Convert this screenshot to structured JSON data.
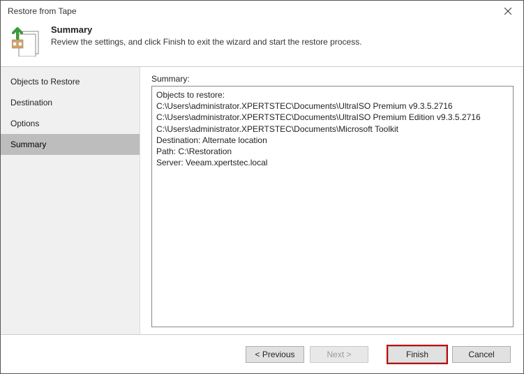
{
  "window": {
    "title": "Restore from Tape"
  },
  "header": {
    "title": "Summary",
    "subtitle": "Review the settings, and click Finish to exit the wizard and start the restore process."
  },
  "sidebar": {
    "items": [
      {
        "label": "Objects to Restore"
      },
      {
        "label": "Destination"
      },
      {
        "label": "Options"
      },
      {
        "label": "Summary"
      }
    ],
    "activeIndex": 3
  },
  "main": {
    "label": "Summary:",
    "summary_text": "Objects to restore:\nC:\\Users\\administrator.XPERTSTEC\\Documents\\UltraISO Premium v9.3.5.2716\nC:\\Users\\administrator.XPERTSTEC\\Documents\\UltraISO Premium Edition v9.3.5.2716\nC:\\Users\\administrator.XPERTSTEC\\Documents\\Microsoft Toolkit\nDestination: Alternate location\nPath: C:\\Restoration\nServer: Veeam.xpertstec.local"
  },
  "footer": {
    "previous": "< Previous",
    "next": "Next >",
    "finish": "Finish",
    "cancel": "Cancel"
  }
}
